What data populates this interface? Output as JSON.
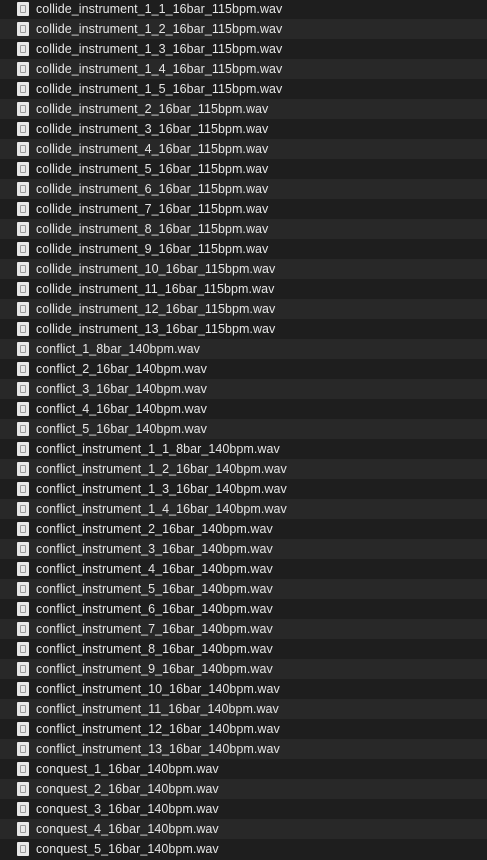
{
  "files": [
    {
      "name": "collide_instrument_1_1_16bar_115bpm.wav",
      "icon": "audio-file-icon"
    },
    {
      "name": "collide_instrument_1_2_16bar_115bpm.wav",
      "icon": "audio-file-icon"
    },
    {
      "name": "collide_instrument_1_3_16bar_115bpm.wav",
      "icon": "audio-file-icon"
    },
    {
      "name": "collide_instrument_1_4_16bar_115bpm.wav",
      "icon": "audio-file-icon"
    },
    {
      "name": "collide_instrument_1_5_16bar_115bpm.wav",
      "icon": "audio-file-icon"
    },
    {
      "name": "collide_instrument_2_16bar_115bpm.wav",
      "icon": "audio-file-icon"
    },
    {
      "name": "collide_instrument_3_16bar_115bpm.wav",
      "icon": "audio-file-icon"
    },
    {
      "name": "collide_instrument_4_16bar_115bpm.wav",
      "icon": "audio-file-icon"
    },
    {
      "name": "collide_instrument_5_16bar_115bpm.wav",
      "icon": "audio-file-icon"
    },
    {
      "name": "collide_instrument_6_16bar_115bpm.wav",
      "icon": "audio-file-icon"
    },
    {
      "name": "collide_instrument_7_16bar_115bpm.wav",
      "icon": "audio-file-icon"
    },
    {
      "name": "collide_instrument_8_16bar_115bpm.wav",
      "icon": "audio-file-icon"
    },
    {
      "name": "collide_instrument_9_16bar_115bpm.wav",
      "icon": "audio-file-icon"
    },
    {
      "name": "collide_instrument_10_16bar_115bpm.wav",
      "icon": "audio-file-icon"
    },
    {
      "name": "collide_instrument_11_16bar_115bpm.wav",
      "icon": "audio-file-icon"
    },
    {
      "name": "collide_instrument_12_16bar_115bpm.wav",
      "icon": "audio-file-icon"
    },
    {
      "name": "collide_instrument_13_16bar_115bpm.wav",
      "icon": "audio-file-icon"
    },
    {
      "name": "conflict_1_8bar_140bpm.wav",
      "icon": "audio-file-icon"
    },
    {
      "name": "conflict_2_16bar_140bpm.wav",
      "icon": "audio-file-icon"
    },
    {
      "name": "conflict_3_16bar_140bpm.wav",
      "icon": "audio-file-icon"
    },
    {
      "name": "conflict_4_16bar_140bpm.wav",
      "icon": "audio-file-icon"
    },
    {
      "name": "conflict_5_16bar_140bpm.wav",
      "icon": "audio-file-icon"
    },
    {
      "name": "conflict_instrument_1_1_8bar_140bpm.wav",
      "icon": "audio-file-icon"
    },
    {
      "name": "conflict_instrument_1_2_16bar_140bpm.wav",
      "icon": "audio-file-icon"
    },
    {
      "name": "conflict_instrument_1_3_16bar_140bpm.wav",
      "icon": "audio-file-icon"
    },
    {
      "name": "conflict_instrument_1_4_16bar_140bpm.wav",
      "icon": "audio-file-icon"
    },
    {
      "name": "conflict_instrument_2_16bar_140bpm.wav",
      "icon": "audio-file-icon"
    },
    {
      "name": "conflict_instrument_3_16bar_140bpm.wav",
      "icon": "audio-file-icon"
    },
    {
      "name": "conflict_instrument_4_16bar_140bpm.wav",
      "icon": "audio-file-icon"
    },
    {
      "name": "conflict_instrument_5_16bar_140bpm.wav",
      "icon": "audio-file-icon"
    },
    {
      "name": "conflict_instrument_6_16bar_140bpm.wav",
      "icon": "audio-file-icon"
    },
    {
      "name": "conflict_instrument_7_16bar_140bpm.wav",
      "icon": "audio-file-icon"
    },
    {
      "name": "conflict_instrument_8_16bar_140bpm.wav",
      "icon": "audio-file-icon"
    },
    {
      "name": "conflict_instrument_9_16bar_140bpm.wav",
      "icon": "audio-file-icon"
    },
    {
      "name": "conflict_instrument_10_16bar_140bpm.wav",
      "icon": "audio-file-icon"
    },
    {
      "name": "conflict_instrument_11_16bar_140bpm.wav",
      "icon": "audio-file-icon"
    },
    {
      "name": "conflict_instrument_12_16bar_140bpm.wav",
      "icon": "audio-file-icon"
    },
    {
      "name": "conflict_instrument_13_16bar_140bpm.wav",
      "icon": "audio-file-icon"
    },
    {
      "name": "conquest_1_16bar_140bpm.wav",
      "icon": "audio-file-icon"
    },
    {
      "name": "conquest_2_16bar_140bpm.wav",
      "icon": "audio-file-icon"
    },
    {
      "name": "conquest_3_16bar_140bpm.wav",
      "icon": "audio-file-icon"
    },
    {
      "name": "conquest_4_16bar_140bpm.wav",
      "icon": "audio-file-icon"
    },
    {
      "name": "conquest_5_16bar_140bpm.wav",
      "icon": "audio-file-icon"
    }
  ],
  "colors": {
    "background": "#1e1e1e",
    "alt_row": "#282828",
    "text": "#e6e6e6",
    "icon": "#e9e9e9"
  }
}
